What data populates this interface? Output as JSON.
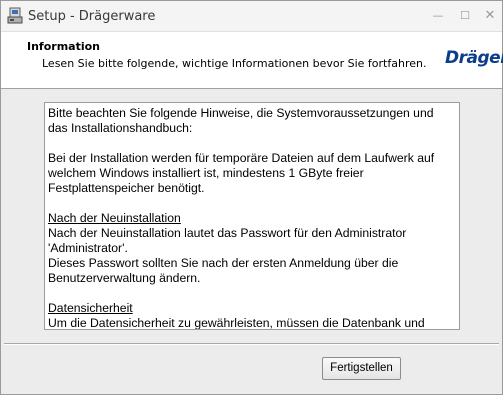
{
  "window": {
    "title": "Setup - Drägerware",
    "minimize_glyph": "—",
    "maximize_glyph": "☐",
    "close_glyph": "✕"
  },
  "header": {
    "title": "Information",
    "subtitle": "Lesen Sie bitte folgende, wichtige Informationen bevor Sie fortfahren.",
    "logo_text": "Dräger",
    "logo_color": "#0b3e8a"
  },
  "info_text": {
    "intro": [
      "Bitte beachten Sie folgende Hinweise, die Systemvoraussetzungen und",
      "das Installationshandbuch:"
    ],
    "install": [
      "Bei der Installation werden für temporäre Dateien auf dem Laufwerk auf",
      "welchem Windows installiert ist, mindestens 1 GByte freier",
      "Festplattenspeicher benötigt."
    ],
    "after_install_heading": "Nach der Neuinstallation",
    "after_install": [
      "Nach der Neuinstallation lautet das Passwort für den Administrator",
      "'Administrator'.",
      "Dieses Passwort sollten Sie nach der ersten Anmeldung über die",
      "Benutzerverwaltung ändern."
    ],
    "security_heading": "Datensicherheit",
    "security": [
      "Um die Datensicherheit zu gewährleisten, müssen die Datenbank und"
    ]
  },
  "buttons": {
    "finish": "Fertigstellen"
  }
}
